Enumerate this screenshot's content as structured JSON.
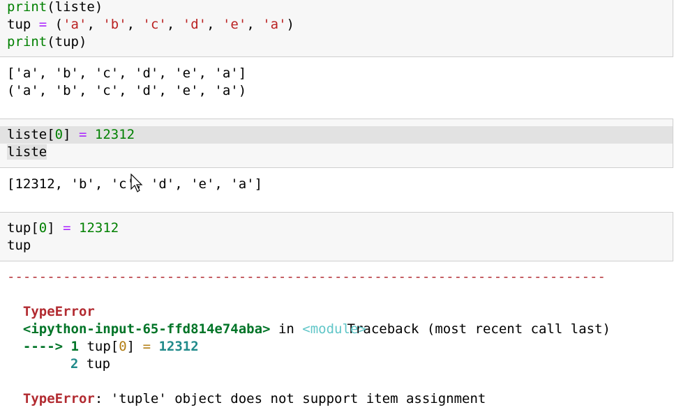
{
  "cell1": {
    "lines": [
      "print(liste)",
      "tup = ('a', 'b', 'c', 'd', 'e', 'a')",
      "print(tup)"
    ],
    "output": [
      "['a', 'b', 'c', 'd', 'e', 'a']",
      "('a', 'b', 'c', 'd', 'e', 'a')"
    ]
  },
  "cell2": {
    "lines": [
      "liste[0] = 12312",
      "liste"
    ],
    "output": "[12312, 'b', 'c', 'd', 'e', 'a']"
  },
  "cell3": {
    "lines": [
      "tup[0] = 12312",
      "tup"
    ],
    "traceback": {
      "dashes": "---------------------------------------------------------------------------",
      "error_type": "TypeError",
      "traceback_label": "Traceback (most recent call last)",
      "input_ref": "<ipython-input-65-ffd814e74aba>",
      "in_word": "in",
      "module": "<module>",
      "arrow": "---->",
      "line1_num": "1",
      "line1_code": "tup[0] = 12312",
      "line2_num": "2",
      "line2_code": "tup",
      "final_error_type": "TypeError",
      "final_message": ": 'tuple' object does not support item assignment"
    }
  }
}
